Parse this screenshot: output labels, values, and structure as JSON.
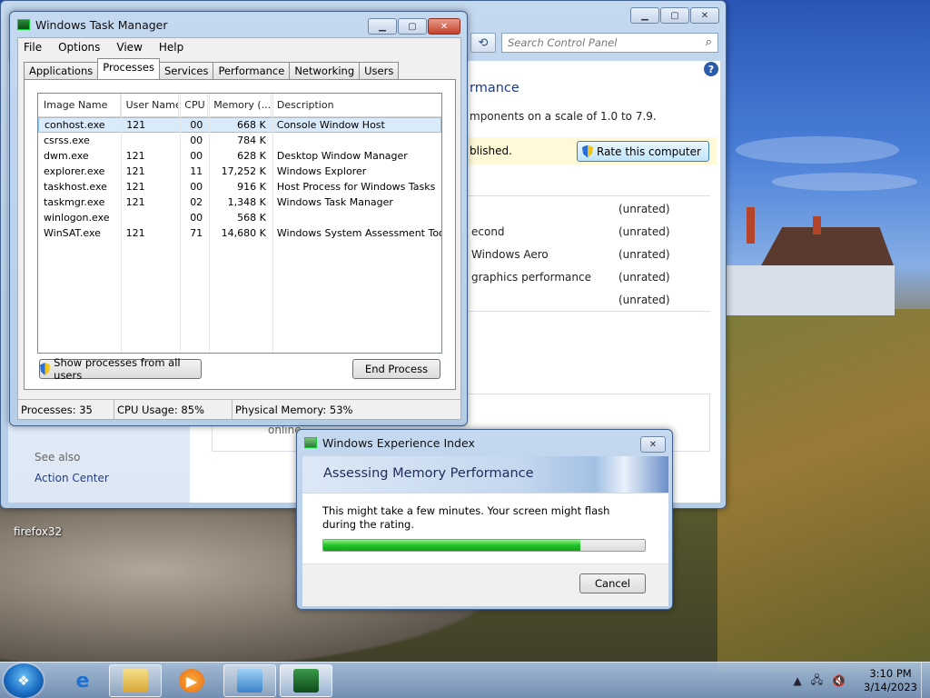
{
  "desktop": {
    "icon_label": "firefox32"
  },
  "control_panel": {
    "search_placeholder": "Search Control Panel",
    "heading_partial": "rmance",
    "scale_text_partial": "mponents on a scale of 1.0 to 7.9.",
    "notice_partial": "blished.",
    "rate_button": "Rate this computer",
    "rows": [
      {
        "label": "",
        "value": "(unrated)"
      },
      {
        "label": "econd",
        "value": "(unrated)"
      },
      {
        "label": "Windows Aero",
        "value": "(unrated)"
      },
      {
        "label": "graphics performance",
        "value": "(unrated)"
      },
      {
        "label": "",
        "value": "(unrated)"
      }
    ],
    "online_partial": "online",
    "see_also": "See also",
    "action_center": "Action Center"
  },
  "task_manager": {
    "title": "Windows Task Manager",
    "menu": [
      "File",
      "Options",
      "View",
      "Help"
    ],
    "tabs": [
      "Applications",
      "Processes",
      "Services",
      "Performance",
      "Networking",
      "Users"
    ],
    "active_tab": "Processes",
    "columns": [
      "Image Name",
      "User Name",
      "CPU",
      "Memory (...",
      "Description"
    ],
    "rows": [
      {
        "image": "conhost.exe",
        "user": "121",
        "cpu": "00",
        "mem": "668 K",
        "desc": "Console Window Host"
      },
      {
        "image": "csrss.exe",
        "user": "",
        "cpu": "00",
        "mem": "784 K",
        "desc": ""
      },
      {
        "image": "dwm.exe",
        "user": "121",
        "cpu": "00",
        "mem": "628 K",
        "desc": "Desktop Window Manager"
      },
      {
        "image": "explorer.exe",
        "user": "121",
        "cpu": "11",
        "mem": "17,252 K",
        "desc": "Windows Explorer"
      },
      {
        "image": "taskhost.exe",
        "user": "121",
        "cpu": "00",
        "mem": "916 K",
        "desc": "Host Process for Windows Tasks"
      },
      {
        "image": "taskmgr.exe",
        "user": "121",
        "cpu": "02",
        "mem": "1,348 K",
        "desc": "Windows Task Manager"
      },
      {
        "image": "winlogon.exe",
        "user": "",
        "cpu": "00",
        "mem": "568 K",
        "desc": ""
      },
      {
        "image": "WinSAT.exe",
        "user": "121",
        "cpu": "71",
        "mem": "14,680 K",
        "desc": "Windows System Assessment Tool"
      }
    ],
    "show_all_button": "Show processes from all users",
    "end_process_button": "End Process",
    "status": {
      "processes": "Processes: 35",
      "cpu": "CPU Usage: 85%",
      "memory": "Physical Memory: 53%"
    }
  },
  "wei_dialog": {
    "title": "Windows Experience Index",
    "banner": "Assessing Memory Performance",
    "message": "This might take a few minutes. Your screen might flash during the rating.",
    "progress_percent": 80,
    "cancel_button": "Cancel"
  },
  "taskbar": {
    "time": "3:10 PM",
    "date": "3/14/2023"
  },
  "colors": {
    "progress_green": "#22c32a",
    "link_blue": "#1e3a8a",
    "selection": "#d9ebfb"
  }
}
